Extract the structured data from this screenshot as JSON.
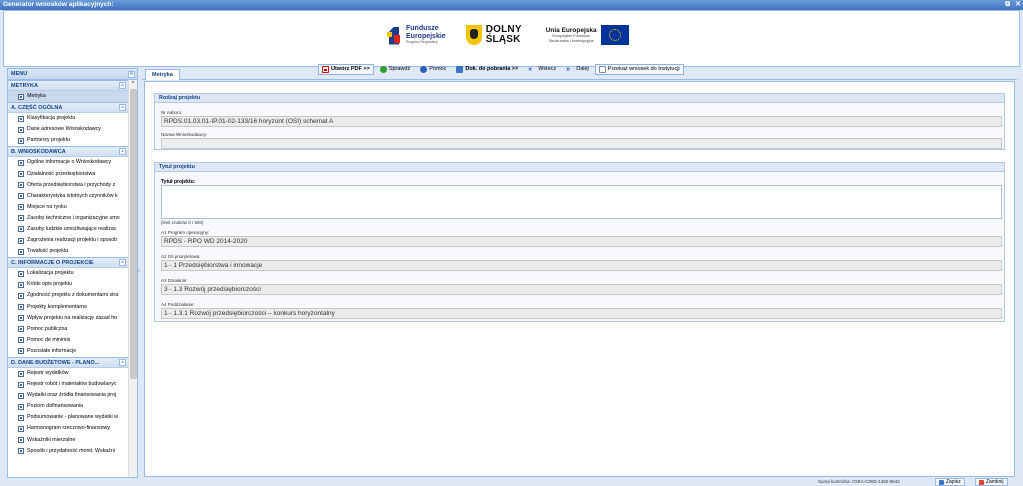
{
  "window": {
    "title": "Generator wniosków aplikacyjnych:",
    "controls": [
      "⧉",
      "✕"
    ]
  },
  "logos": {
    "fe_title": "Fundusze Europejskie",
    "fe_line1": "Fundusze",
    "fe_line2": "Europejskie",
    "fe_sub": "Program Regionalny",
    "ds_line1": "DOLNY",
    "ds_line2": "ŚLĄSK",
    "ue_title": "Unia Europejska",
    "ue_sub1": "Europejskie Fundusze",
    "ue_sub2": "Strukturalne i Inwestycyjne"
  },
  "toolbar": {
    "create_pdf": "Utwórz PDF >>",
    "check": "Sprawdź",
    "help": "Pomoc",
    "downloads": "Dok. do pobrania >>",
    "back": "Wstecz",
    "next": "Dalej",
    "send": "Przekaż wniosek do Instytucji"
  },
  "menu": {
    "header": "MENU",
    "collapse": "«",
    "groups": [
      {
        "title": "METRYKA",
        "items": [
          "Metryka"
        ]
      },
      {
        "title": "A. CZĘŚĆ OGÓLNA",
        "items": [
          "Klasyfikacja projektu",
          "Dane adresowe Wnioskodawcy",
          "Partnerzy projektu"
        ]
      },
      {
        "title": "B. WNIOSKODAWCA",
        "items": [
          "Ogólne informacje o Wnioskodawcy",
          "Działalność przedsiębiorstwa",
          "Oferta przedsiębiorstwa i przychody z",
          "Charakterystyka istotnych czynników k",
          "Miejsce na rynku",
          "Zasoby techniczne i organizacyjne umo",
          "Zasoby ludzkie umożliwiające realizac",
          "Zagrożenia realizacji projektu i sposob",
          "Trwałość projektu"
        ]
      },
      {
        "title": "C. INFORMACJE O PROJEKCIE",
        "items": [
          "Lokalizacja projektu",
          "Krótki opis projektu",
          "Zgodność projektu z dokumentami stra",
          "Projekty komplementarne",
          "Wpływ projektu na realizację zasad ho",
          "Pomoc publiczna",
          "Pomoc de minimis",
          "Pozostałe informacje"
        ]
      },
      {
        "title": "D. DANE BUDŻETOWE - PLANO...",
        "items": [
          "Rejestr wydatków",
          "Rejestr robót i materiałów budowlanyc",
          "Wydatki oraz źródła finansowania proj",
          "Poziom dofinansowania",
          "Podsumowanie - planowane wydatki w",
          "Harmonogram rzeczowo-finansowy",
          "Wskaźniki mierzalne",
          "Sposób i przydatność monit. Wskaźni"
        ]
      }
    ]
  },
  "tab": {
    "label": "Metryka"
  },
  "form": {
    "section1_title": "Rodzaj projektu",
    "nabor_label": "Nr naboru:",
    "nabor_value": "RPDS.01.03.01-IP.01-02-133/16 horyzont (OSI) schemat A",
    "wnioskodawca_label": "Nazwa Wnioskodawcy:",
    "wnioskodawca_value": "",
    "section2_title": "Tytuł projektu",
    "tytul_label": "Tytuł projektu:",
    "tytul_value": "",
    "limit_text": "(limit znaków 0 / 500)",
    "a1_label": "A1 Program operacyjny:",
    "a1_value": "RPDS - RPO WD 2014-2020",
    "a2_label": "A2 Oś priorytetowa:",
    "a2_value": "1 - 1 Przedsiębiorstwa i innowacje",
    "a3_label": "A3 Działanie:",
    "a3_value": "3 - 1.3 Rozwój przedsiębiorczości",
    "a4_label": "A4 Poddziałanie:",
    "a4_value": "1 - 1.3.1 Rozwój przedsiębiorczości – konkurs horyzontalny"
  },
  "status": {
    "checksum": "Suma kontrolna: C5EA-C00D-1482-0542",
    "save": "Zapisz",
    "close": "Zamknij"
  }
}
